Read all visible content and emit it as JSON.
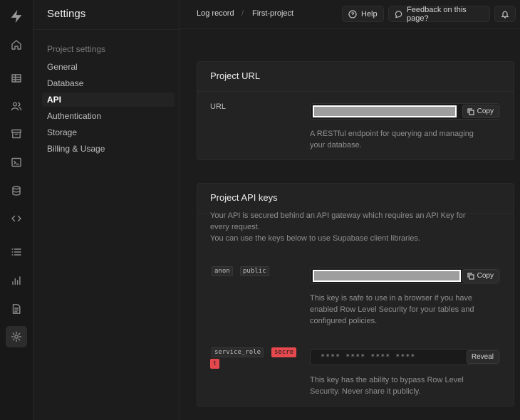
{
  "rail": {
    "icons": [
      "logo-icon",
      "home-icon",
      "table-editor-icon",
      "users-icon",
      "storage-icon",
      "sql-editor-icon",
      "database-icon",
      "api-docs-icon",
      "logs-icon",
      "reports-icon",
      "docs-icon",
      "settings-icon"
    ]
  },
  "menu": {
    "title": "Settings",
    "group_label": "Project settings",
    "items": [
      {
        "label": "General",
        "active": false
      },
      {
        "label": "Database",
        "active": false
      },
      {
        "label": "API",
        "active": true
      },
      {
        "label": "Authentication",
        "active": false
      },
      {
        "label": "Storage",
        "active": false
      },
      {
        "label": "Billing & Usage",
        "active": false
      }
    ]
  },
  "topbar": {
    "breadcrumbs": [
      "Log record",
      "First-project"
    ],
    "help_label": "Help",
    "feedback_label": "Feedback on this page?"
  },
  "project_url": {
    "heading": "Project URL",
    "field_label": "URL",
    "copy_label": "Copy",
    "help_line1": "A RESTful endpoint for querying and managing",
    "help_line2": "your database."
  },
  "api_keys": {
    "heading": "Project API keys",
    "desc_line1": "Your API is secured behind an API gateway which requires an API Key for",
    "desc_line2": "every request.",
    "desc_line3": "You can use the keys below to use Supabase client libraries.",
    "anon": {
      "tags": [
        "anon",
        "public"
      ],
      "copy_label": "Copy",
      "help_line1": "This key is safe to use in a browser if you have",
      "help_line2": "enabled Row Level Security for your tables and",
      "help_line3": "configured policies."
    },
    "service": {
      "tags": [
        "service_role",
        "secre",
        "t"
      ],
      "masked_value": "**** **** **** ****",
      "reveal_label": "Reveal",
      "help_line1": "This key has the ability to bypass Row Level",
      "help_line2": "Security. Never share it publicly."
    }
  },
  "colors": {
    "background": "#1c1c1c",
    "card": "#232323",
    "secret_tag": "#e5484d",
    "text": "#ededed",
    "muted_text": "#8f8f8f"
  }
}
